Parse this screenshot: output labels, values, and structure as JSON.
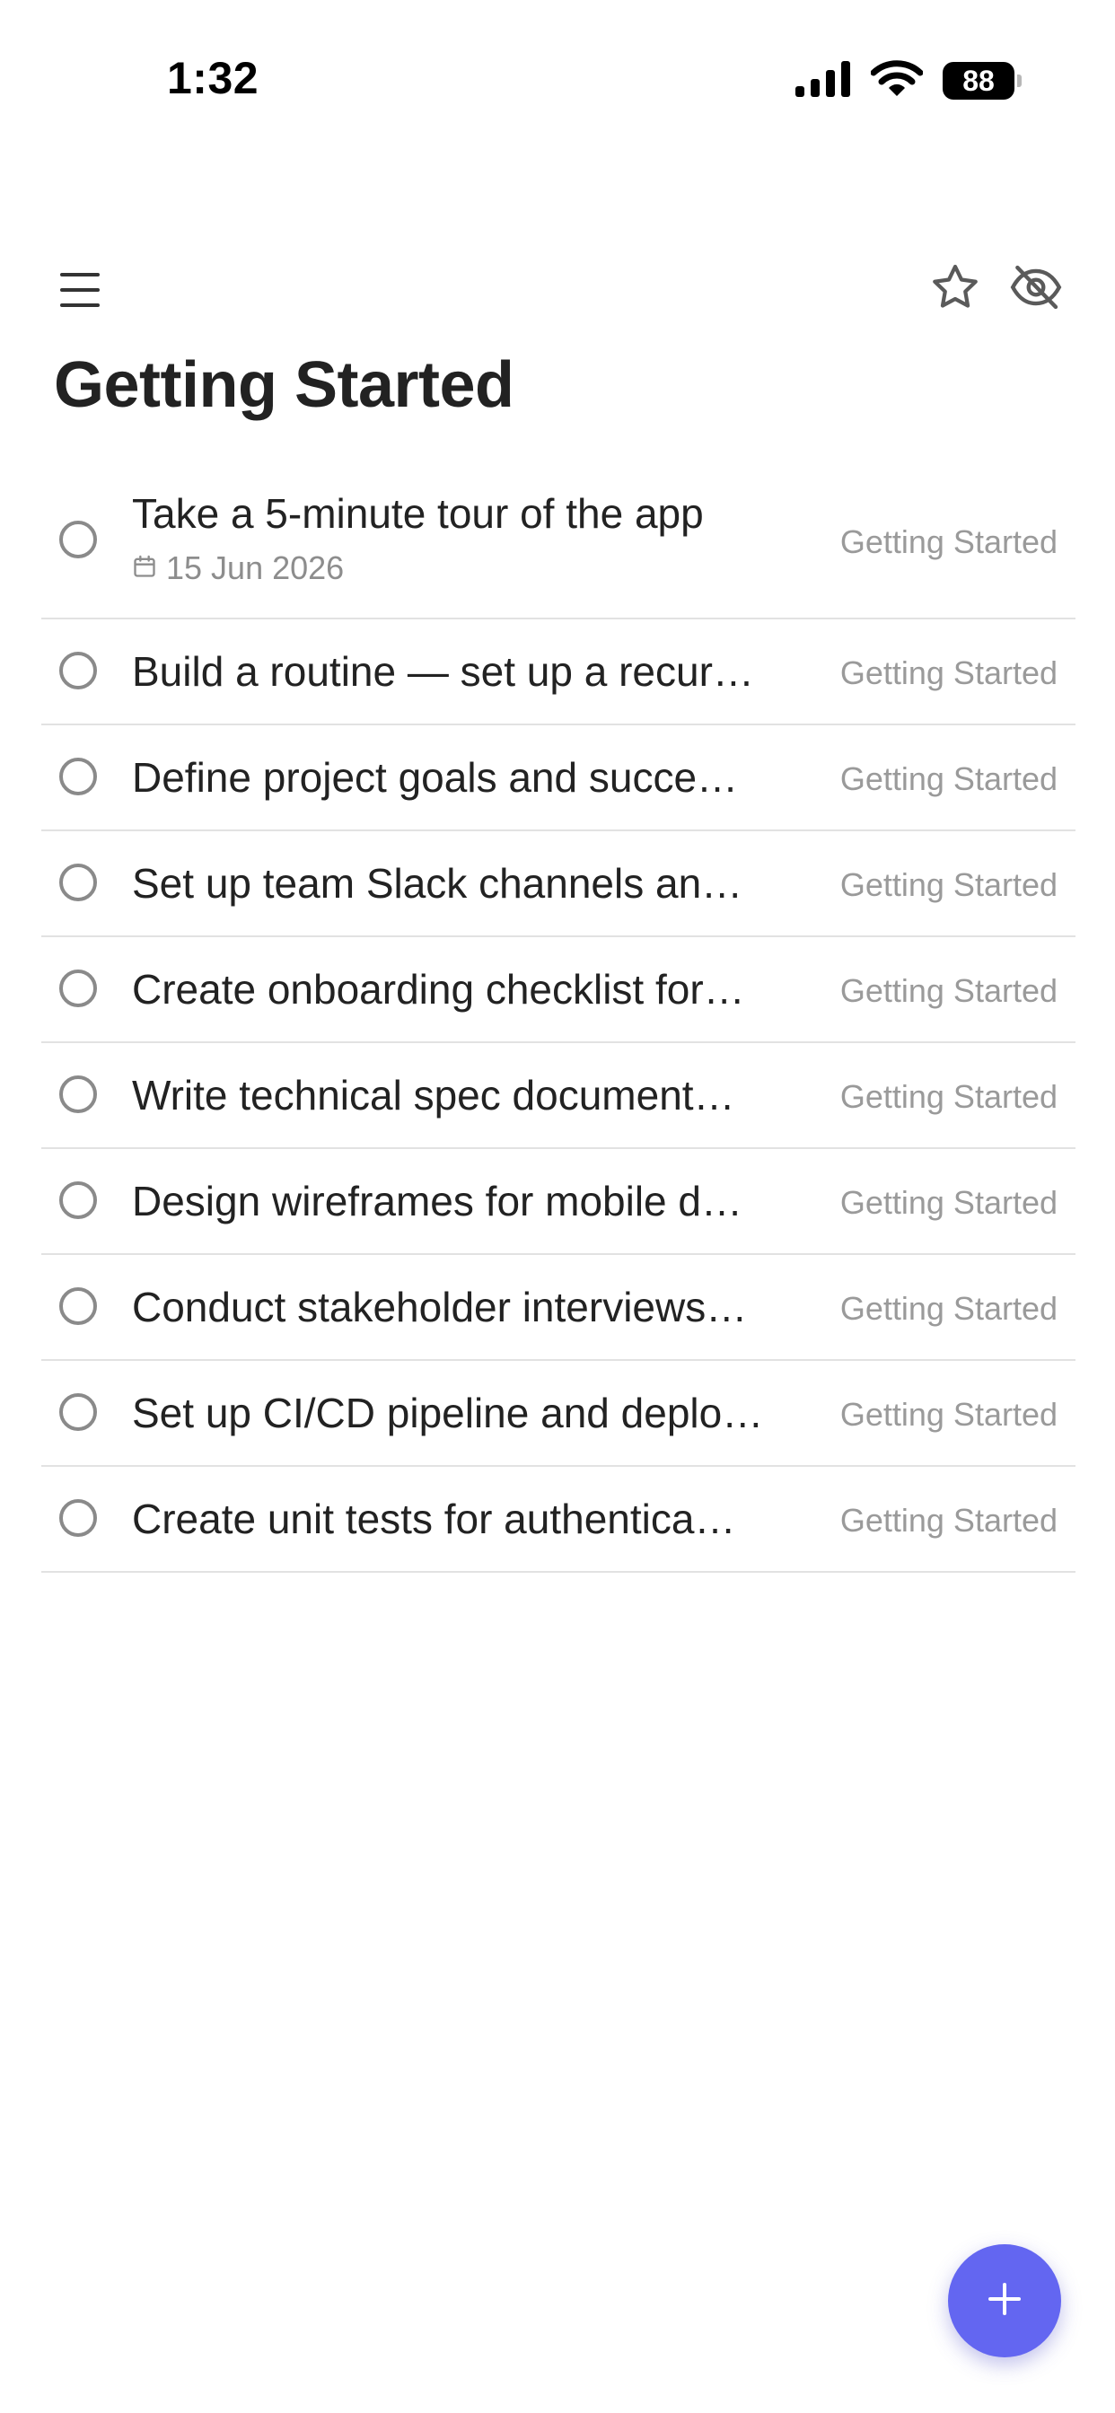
{
  "status_bar": {
    "time": "1:32",
    "battery": "88",
    "icons": [
      "signal-icon",
      "wifi-icon",
      "battery-icon"
    ]
  },
  "header": {
    "title": "Getting Started",
    "icons": {
      "menu": "menu-icon",
      "favorite": "star-icon",
      "visibility": "eye-off-icon"
    }
  },
  "tasks": [
    {
      "title": "Take a 5-minute tour of the app",
      "date": "15 Jun 2026",
      "project": "Getting Started"
    },
    {
      "title": "Build a routine — set up a recur…",
      "project": "Getting Started"
    },
    {
      "title": "Define project goals and succe…",
      "project": "Getting Started"
    },
    {
      "title": "Set up team Slack channels an…",
      "project": "Getting Started"
    },
    {
      "title": "Create onboarding checklist for…",
      "project": "Getting Started"
    },
    {
      "title": "Write technical spec document…",
      "project": "Getting Started"
    },
    {
      "title": "Design wireframes for mobile d…",
      "project": "Getting Started"
    },
    {
      "title": "Conduct stakeholder interviews…",
      "project": "Getting Started"
    },
    {
      "title": "Set up CI/CD pipeline and deplo…",
      "project": "Getting Started"
    },
    {
      "title": "Create unit tests for authentica…",
      "project": "Getting Started"
    }
  ],
  "fab": {
    "icon": "plus-icon"
  },
  "colors": {
    "accent": "#6366f1",
    "text": "#222222",
    "muted": "#9a9a9a",
    "divider": "#e2e2e2"
  }
}
